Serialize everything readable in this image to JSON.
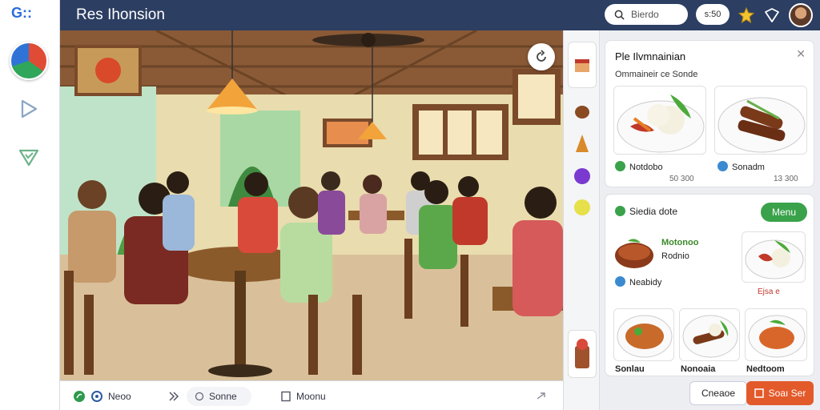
{
  "app": {
    "title": "Res Ihonsion",
    "logo": "G::"
  },
  "topbar": {
    "search_placeholder": "Bierdo",
    "pill_label": "s:50",
    "icons": [
      "search-icon",
      "star-badge-icon",
      "shield-icon",
      "user-avatar"
    ]
  },
  "rail": {
    "icons": [
      "app-logo",
      "user-avatar",
      "play-icon",
      "shield-check-icon"
    ]
  },
  "bottombar": {
    "item1": "Neoo",
    "item2": "Sonne",
    "item3": "Moonu"
  },
  "panel": {
    "top_card": {
      "title": "Ple Ilvmnainian",
      "subtitle": "Ommaineir ce Sonde",
      "dish1": {
        "name": "Notdobo",
        "price": "50 300"
      },
      "dish2": {
        "name": "Sonadm",
        "price": "13 300"
      }
    },
    "menu_card": {
      "title": "Siedia dote",
      "menu_button": "Menu",
      "feature_title": "Motonoo",
      "feature_sub": "Rodnio",
      "feature_tag": "Neabidy",
      "price_tag": "Ejsa e",
      "grid": [
        {
          "name": "Sonlau",
          "sub": ""
        },
        {
          "name": "Nonoaia",
          "sub": ""
        },
        {
          "name": "Nedtoom",
          "sub": ""
        }
      ]
    },
    "footer": {
      "secondary": "Cneaoe",
      "primary": "Soaı Ser"
    }
  },
  "colors": {
    "topbar": "#2c3e62",
    "accent_green": "#3aa24a",
    "accent_orange": "#e35a2a"
  }
}
